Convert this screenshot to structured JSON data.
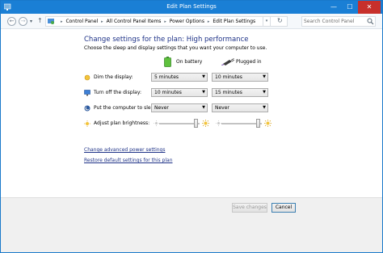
{
  "window": {
    "title": "Edit Plan Settings",
    "close_glyph": "✕",
    "min_glyph": "—",
    "max_glyph": "☐"
  },
  "nav": {
    "back_glyph": "←",
    "forward_glyph": "→",
    "up_glyph": "↑",
    "recent_glyph": "▾",
    "breadcrumbs": [
      "Control Panel",
      "All Control Panel Items",
      "Power Options",
      "Edit Plan Settings"
    ],
    "crumb_separator": "▸",
    "dropdown_glyph": "▾",
    "refresh_glyph": "↻",
    "search_placeholder": "Search Control Panel"
  },
  "main": {
    "heading": "Change settings for the plan: High performance",
    "subheading": "Choose the sleep and display settings that you want your computer to use.",
    "columns": {
      "battery": "On battery",
      "plugged": "Plugged in"
    },
    "rows": [
      {
        "label": "Dim the display:",
        "battery": "5 minutes",
        "plugged": "10 minutes",
        "icon": "dim-display-icon"
      },
      {
        "label": "Turn off the display:",
        "battery": "10 minutes",
        "plugged": "15 minutes",
        "icon": "monitor-icon"
      },
      {
        "label": "Put the computer to sleep:",
        "battery": "Never",
        "plugged": "Never",
        "icon": "sleep-icon"
      }
    ],
    "brightness": {
      "label": "Adjust plan brightness:",
      "battery_level": 0.86,
      "plugged_level": 0.86
    },
    "dropdown_arrow": "▼",
    "links": {
      "advanced": "Change advanced power settings",
      "restore": "Restore default settings for this plan"
    }
  },
  "footer": {
    "save": "Save changes",
    "cancel": "Cancel"
  },
  "colors": {
    "titlebar": "#1a7fd5",
    "heading": "#1e3287",
    "close": "#c7302b"
  }
}
